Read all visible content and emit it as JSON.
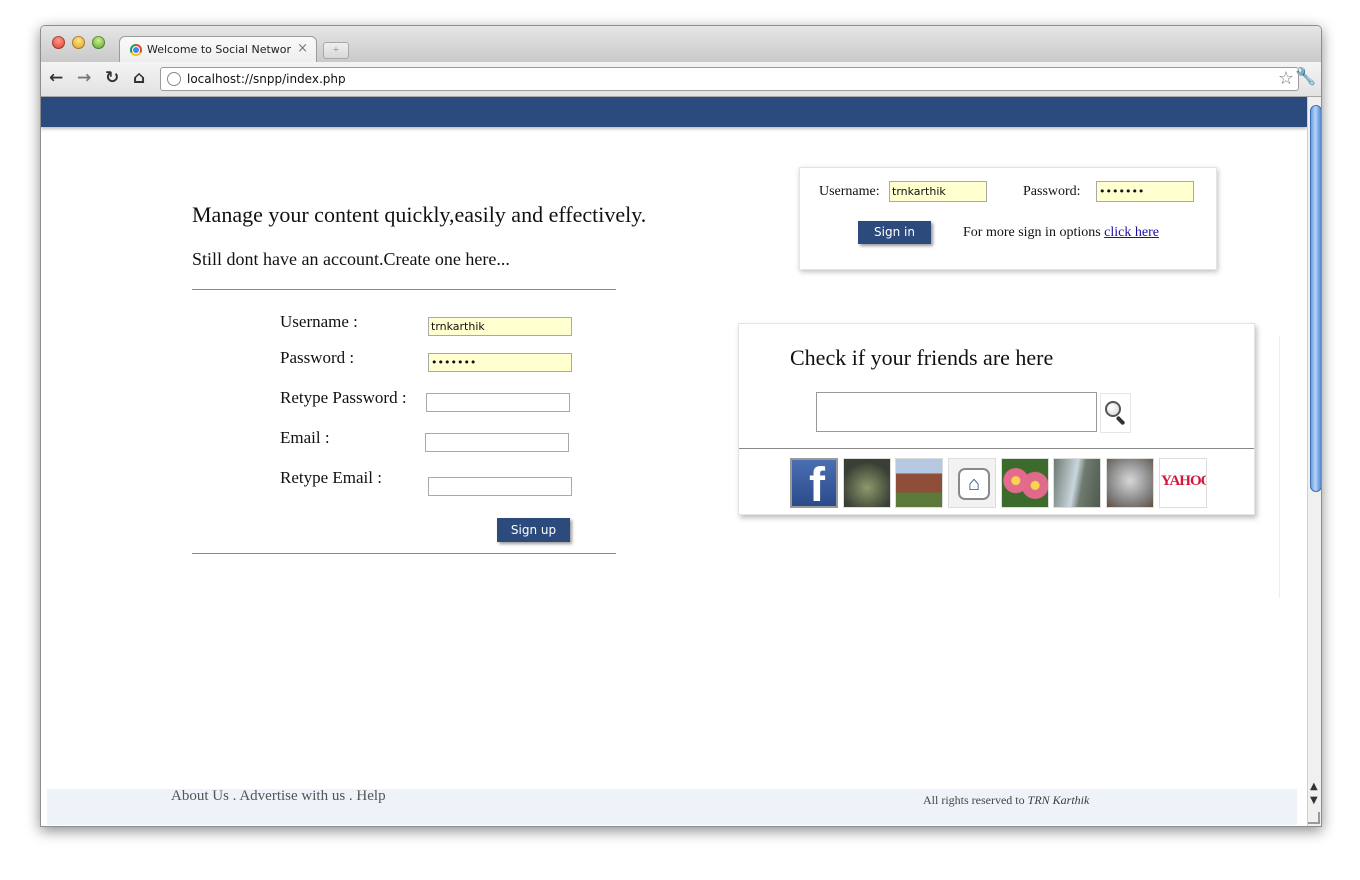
{
  "browser": {
    "tab_title": "Welcome to Social Networking",
    "tab_close": "×",
    "new_tab": "+",
    "url": "localhost://snpp/index.php"
  },
  "left": {
    "slogan": "Manage your content quickly,easily and effectively.",
    "subtitle": "Still dont have an account.Create one here...",
    "form": {
      "username_label": "Username :",
      "username_value": "trnkarthik",
      "password_label": "Password :",
      "password_value": "•••••••",
      "retype_password_label": "Retype Password :",
      "email_label": "Email :",
      "retype_email_label": "Retype Email :",
      "signup_button": "Sign up"
    }
  },
  "login": {
    "username_label": "Username:",
    "username_value": "trnkarthik",
    "password_label": "Password:",
    "password_value": "•••••••",
    "signin_button": "Sign in",
    "more_text": "For more sign in options",
    "more_link": "click here"
  },
  "friends": {
    "title": "Check if your friends are here",
    "search_value": "",
    "thumbnails": [
      "facebook",
      "desert",
      "building",
      "home",
      "flowers",
      "waterfall",
      "koala",
      "yahoo"
    ],
    "yahoo_text": "YAHOO!",
    "facebook_text": "f"
  },
  "footer": {
    "links": "About Us . Advertise with us . Help",
    "rights": "All rights reserved to",
    "owner": "TRN Karthik"
  },
  "colors": {
    "banner": "#2b4a7d",
    "button": "#2d4a7c",
    "filled_input": "#ffffd0",
    "footer_bg": "#eef3fa"
  }
}
